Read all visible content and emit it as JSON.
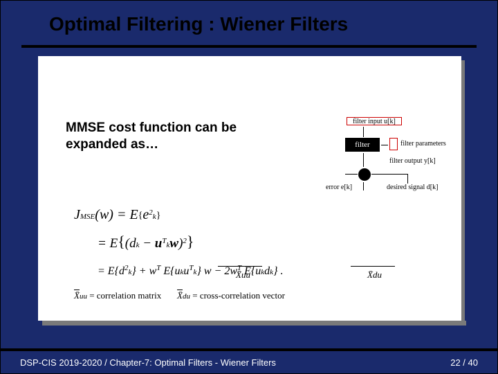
{
  "title": "Optimal Filtering : Wiener Filters",
  "lead": "MMSE cost function can be expanded as…",
  "diagram": {
    "filter_input": "filter input u[k]",
    "filter_block": "filter",
    "filter_params": "filter parameters",
    "filter_output": "filter output y[k]",
    "error": "error e[k]",
    "desired": "desired signal d[k]"
  },
  "formula": {
    "line1_left": "J",
    "line1_sub": "MSE",
    "line1_arg": "(w)",
    "line1_eq": " = E",
    "line1_braced": "e",
    "line1_bsub": "k",
    "line1_bsup": "2",
    "line2_eq": "= E",
    "line2_inner_a": "d",
    "line2_inner_a_sub": "k",
    "line2_minus": " − ",
    "line2_inner_b": "u",
    "line2_inner_b_sub": "k",
    "line2_inner_b_sup": "T",
    "line2_w": "w",
    "line2_sup": "2",
    "line3_eq": "= ",
    "line3_t1": "E{d",
    "line3_t1_sub": "k",
    "line3_t1_sup": "2",
    "line3_t1_close": "}",
    "line3_plus1": " + w",
    "line3_wT": "T",
    "line3_t2": " E{u",
    "line3_t2_sub": "k",
    "line3_t2b": "u",
    "line3_t2b_sub": "k",
    "line3_t2b_sup": "T",
    "line3_t2_close": "} w",
    "line3_minus": " − 2w",
    "line3_wT2": "T",
    "line3_t3": " E{u",
    "line3_t3_sub": "k",
    "line3_t3b": "d",
    "line3_t3b_sub": "k",
    "line3_t3_close": "} .",
    "xuu": "X̄uu",
    "xdu": "X̄du"
  },
  "footnote": {
    "xuu_lhs": "X̄",
    "xuu_sub": "uu",
    "xuu_eq": " = correlation matrix",
    "gap": "      ",
    "xdu_lhs": "X̄",
    "xdu_sub": "du",
    "xdu_eq": " = cross-correlation vector"
  },
  "footer": {
    "left": "DSP-CIS 2019-2020  /  Chapter-7: Optimal Filters - Wiener Filters",
    "right": "22 / 40"
  }
}
